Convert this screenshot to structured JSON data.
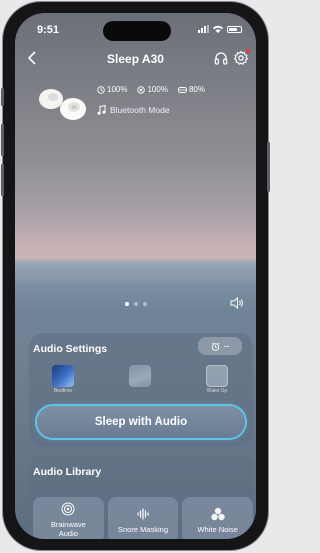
{
  "status": {
    "time": "9:51"
  },
  "header": {
    "title": "Sleep A30"
  },
  "device": {
    "stats": [
      {
        "icon": "clock-icon",
        "value": "100%"
      },
      {
        "icon": "case-icon",
        "value": "100%"
      },
      {
        "icon": "battery-case-icon",
        "value": "80%"
      }
    ],
    "mode_label": "Bluetooth Mode"
  },
  "audio_settings": {
    "title": "Audio Settings",
    "timer_value": "--",
    "tiles": [
      {
        "label": "Bedtime"
      },
      {
        "label": ""
      },
      {
        "label": "Wake Up"
      }
    ],
    "primary_button": "Sleep with Audio"
  },
  "audio_library": {
    "title": "Audio Library",
    "items": [
      {
        "label_line1": "Brainwave",
        "label_line2": "Audio",
        "icon": "brainwave-icon"
      },
      {
        "label_line1": "Snore Masking",
        "label_line2": "",
        "icon": "soundwave-icon"
      },
      {
        "label_line1": "White Noise",
        "label_line2": "",
        "icon": "white-noise-icon"
      }
    ]
  },
  "colors": {
    "accent_ring": "#5ec4e8",
    "notification_dot": "#e23b3b"
  }
}
